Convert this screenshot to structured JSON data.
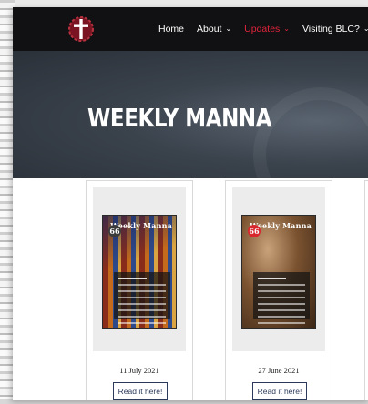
{
  "nav": {
    "items": [
      {
        "label": "Home",
        "has_dropdown": false,
        "active": false
      },
      {
        "label": "About",
        "has_dropdown": true,
        "active": false
      },
      {
        "label": "Updates",
        "has_dropdown": true,
        "active": true
      },
      {
        "label": "Visiting BLC?",
        "has_dropdown": true,
        "active": false
      }
    ],
    "chevron": "⌄",
    "active_color": "#e2233b",
    "background": "#111113"
  },
  "hero": {
    "title": "WEEKLY MANNA"
  },
  "cards": [
    {
      "poster_head": "Weekly Manna",
      "badge": "66",
      "date": "11 July 2021",
      "button": "Read it here!"
    },
    {
      "poster_head": "Weekly Manna",
      "badge": "66",
      "date": "27 June 2021",
      "button": "Read it here!"
    }
  ],
  "colors": {
    "button_border": "#2b3a5a",
    "badge_red": "#d9272e"
  }
}
